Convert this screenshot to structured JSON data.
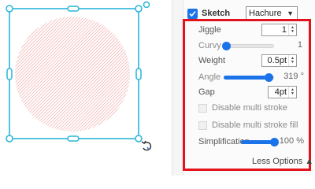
{
  "canvas": {
    "shape_fill_color": "#f2b8b8",
    "selection_color": "#29b6d8",
    "rotate_icon": "rotate-icon",
    "shape_type": "circle with hachure sketch fill"
  },
  "panel": {
    "sketch": {
      "label": "Sketch",
      "checked": true,
      "fill_style": "Hachure",
      "dropdown_icon": "chevron-down-icon"
    },
    "jiggle": {
      "label": "Jiggle",
      "value": "1"
    },
    "curvy": {
      "label": "Curvy",
      "value": "1",
      "level": 0.05
    },
    "weight": {
      "label": "Weight",
      "value": "0.5pt"
    },
    "angle": {
      "label": "Angle",
      "value": "319 °",
      "level": 0.886
    },
    "gap": {
      "label": "Gap",
      "value": "4pt"
    },
    "disable_multi_stroke": {
      "label": "Disable multi stroke",
      "checked": false
    },
    "disable_multi_stroke_fill": {
      "label": "Disable multi stroke fill",
      "checked": false
    },
    "simplification": {
      "label": "Simplification",
      "value": "100 %",
      "level": 1.0
    },
    "less_options": {
      "label": "Less Options ▲"
    }
  },
  "colors": {
    "accent": "#1a73e8",
    "highlight_border": "#e3131d"
  }
}
